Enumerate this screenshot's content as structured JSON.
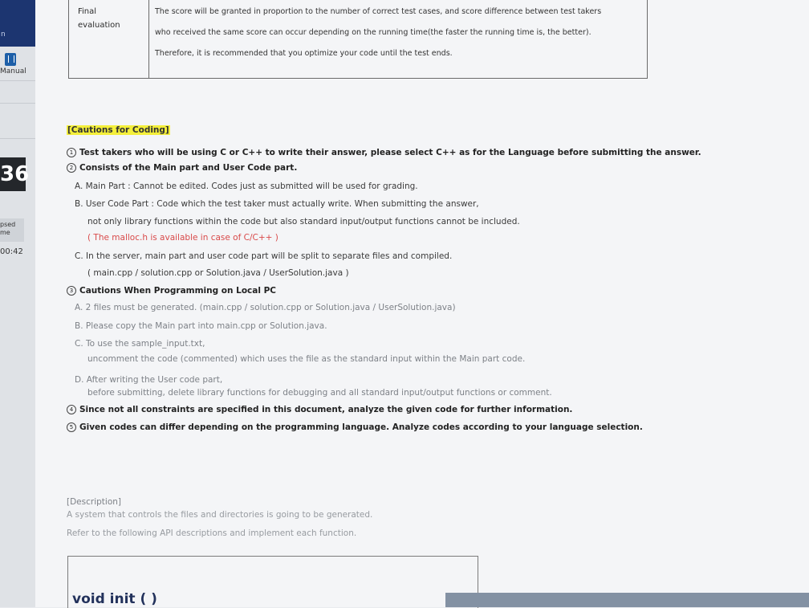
{
  "sidebar": {
    "top_fragment": "n",
    "manual_label": "Manual",
    "counter": "36",
    "elapsed_label": "psed\nme",
    "elapsed_time": "00:42"
  },
  "eval_table": {
    "label_line1": "Final",
    "label_line2": "evaluation",
    "lines": [
      "The score will be granted in proportion to the number of correct test cases, and score difference between test takers",
      "who received the same score can occur depending on the running time(the faster the running time is, the better).",
      "Therefore, it is recommended  that you optimize your code until the test ends."
    ]
  },
  "cautions": {
    "title": "[Cautions for Coding]",
    "items": [
      {
        "num": "1",
        "text": "Test takers who will be using C or C++ to write their answer, please select C++ as for the Language before submitting the answer."
      },
      {
        "num": "2",
        "text": "Consists of the Main part and User Code part."
      }
    ],
    "a_main": "A. Main Part : Cannot be edited. Codes just as submitted will be used for grading.",
    "b_user_1": "B. User Code Part : Code which the test taker must actually write. When submitting the answer,",
    "b_user_2": "not only library functions within the code but also standard input/output functions cannot be included.",
    "b_user_note": "( The malloc.h is available in case of C/C++ )",
    "c_server_1": "C. In the server, main part and user code part will be split to separate files and compiled.",
    "c_server_2": "( main.cpp / solution.cpp or Solution.java / UserSolution.java )",
    "item3": {
      "num": "3",
      "text": "Cautions When Programming on Local PC"
    },
    "l_a": "A. 2 files must be generated. (main.cpp / solution.cpp or Solution.java / UserSolution.java)",
    "l_b": "B. Please copy the Main part into main.cpp or Solution.java.",
    "l_c1": "C. To use the sample_input.txt,",
    "l_c2": "uncomment the code (commented) which uses the file as the standard input within the Main part code.",
    "l_d1": "D. After writing the User code part,",
    "l_d2": "before submitting, delete library functions for debugging and all standard input/output functions or comment.",
    "item4": {
      "num": "4",
      "text": "Since not all constraints are specified in this document, analyze the given code for further information."
    },
    "item5": {
      "num": "5",
      "text": "Given codes can differ depending on the programming language. Analyze codes according to your language selection."
    }
  },
  "description": {
    "title": "[Description]",
    "line1": "A system that controls the files and directories is going to be generated.",
    "line2": "Refer to the following API descriptions and implement each function."
  },
  "code": {
    "signature": "void init ( )"
  }
}
